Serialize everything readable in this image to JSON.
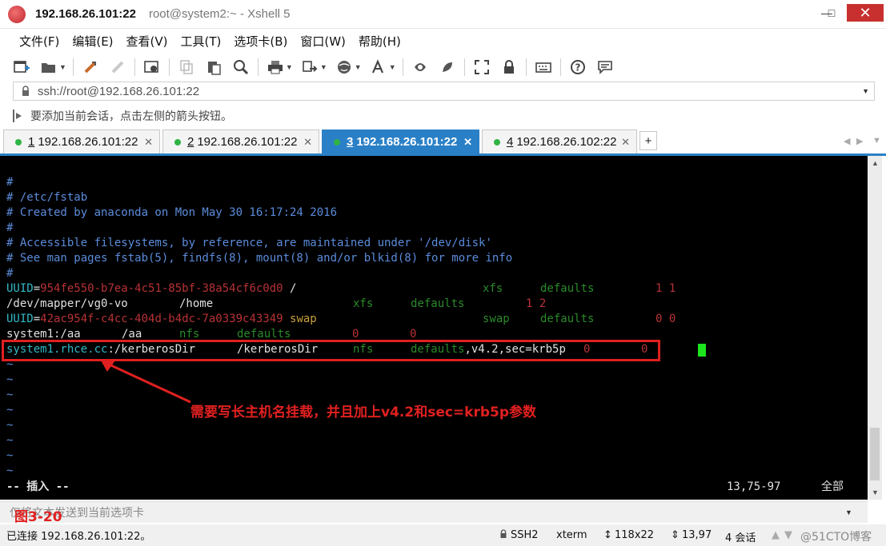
{
  "window": {
    "host": "192.168.26.101:22",
    "subtitle": "root@system2:~ - Xshell 5",
    "minimize": "—",
    "maximize": "□",
    "close": "✕"
  },
  "menu": [
    "文件(F)",
    "编辑(E)",
    "查看(V)",
    "工具(T)",
    "选项卡(B)",
    "窗口(W)",
    "帮助(H)"
  ],
  "address": {
    "value": "ssh://root@192.168.26.101:22"
  },
  "hint": "要添加当前会话，点击左侧的箭头按钮。",
  "tabs": [
    {
      "num": "1",
      "label": "192.168.26.101:22",
      "active": false
    },
    {
      "num": "2",
      "label": "192.168.26.101:22",
      "active": false
    },
    {
      "num": "3",
      "label": "192.168.26.101:22",
      "active": true
    },
    {
      "num": "4",
      "label": "192.168.26.102:22",
      "active": false
    }
  ],
  "tab_add": "+",
  "terminal": {
    "comment_lines": [
      "#",
      "# /etc/fstab",
      "# Created by anaconda on Mon May 30 16:17:24 2016",
      "#",
      "# Accessible filesystems, by reference, are maintained under '/dev/disk'",
      "# See man pages fstab(5), findfs(8), mount(8) and/or blkid(8) for more info",
      "#"
    ],
    "row1": {
      "key": "UUID",
      "eq": "=",
      "value": "954fe550-b7ea-4c51-85bf-38a54cf6c0d0",
      "mount": " /",
      "fs": "xfs",
      "opts": "defaults",
      "nums": "1 1"
    },
    "row2": {
      "dev": "/dev/mapper/vg0-vo",
      "mount": "/home",
      "fs": "xfs",
      "opts": "defaults",
      "nums": "1 2"
    },
    "row3": {
      "key": "UUID",
      "eq": "=",
      "value": "42ac954f-c4cc-404d-b4dc-7a0339c43349",
      "mount": " swap",
      "fs": "swap",
      "opts": "defaults",
      "nums": "0 0"
    },
    "row4": {
      "dev": "system1:/aa",
      "mount": "/aa",
      "fs": "nfs",
      "opts": "defaults",
      "n1": "0",
      "n2": "0"
    },
    "row5": {
      "host": "system1.rhce.cc",
      "path": ":/kerberosDir",
      "mount": "/kerberosDir",
      "fs": "nfs",
      "opts": "defaults",
      "extra": ",v4.2,sec=krb5p",
      "n1": "0",
      "n2": "0"
    },
    "tilde": "~",
    "mode": "-- 插入 --",
    "position": "13,75-97",
    "scope": "全部"
  },
  "annotation": "需要写长主机名挂载，并且加上v4.2和sec=krb5p参数",
  "figure_label": "图3-20",
  "send_bar": "仅将文本发送到当前选项卡",
  "status": {
    "connected": "已连接 192.168.26.101:22。",
    "protocol": "SSH2",
    "term": "xterm",
    "size": "118x22",
    "cursor": "13,97",
    "sessions": "4 会话",
    "watermark": "@51CTO博客"
  },
  "colors": {
    "accent": "#2a80c6",
    "annotation_red": "#e02020",
    "cursor_green": "#1ee41e"
  }
}
